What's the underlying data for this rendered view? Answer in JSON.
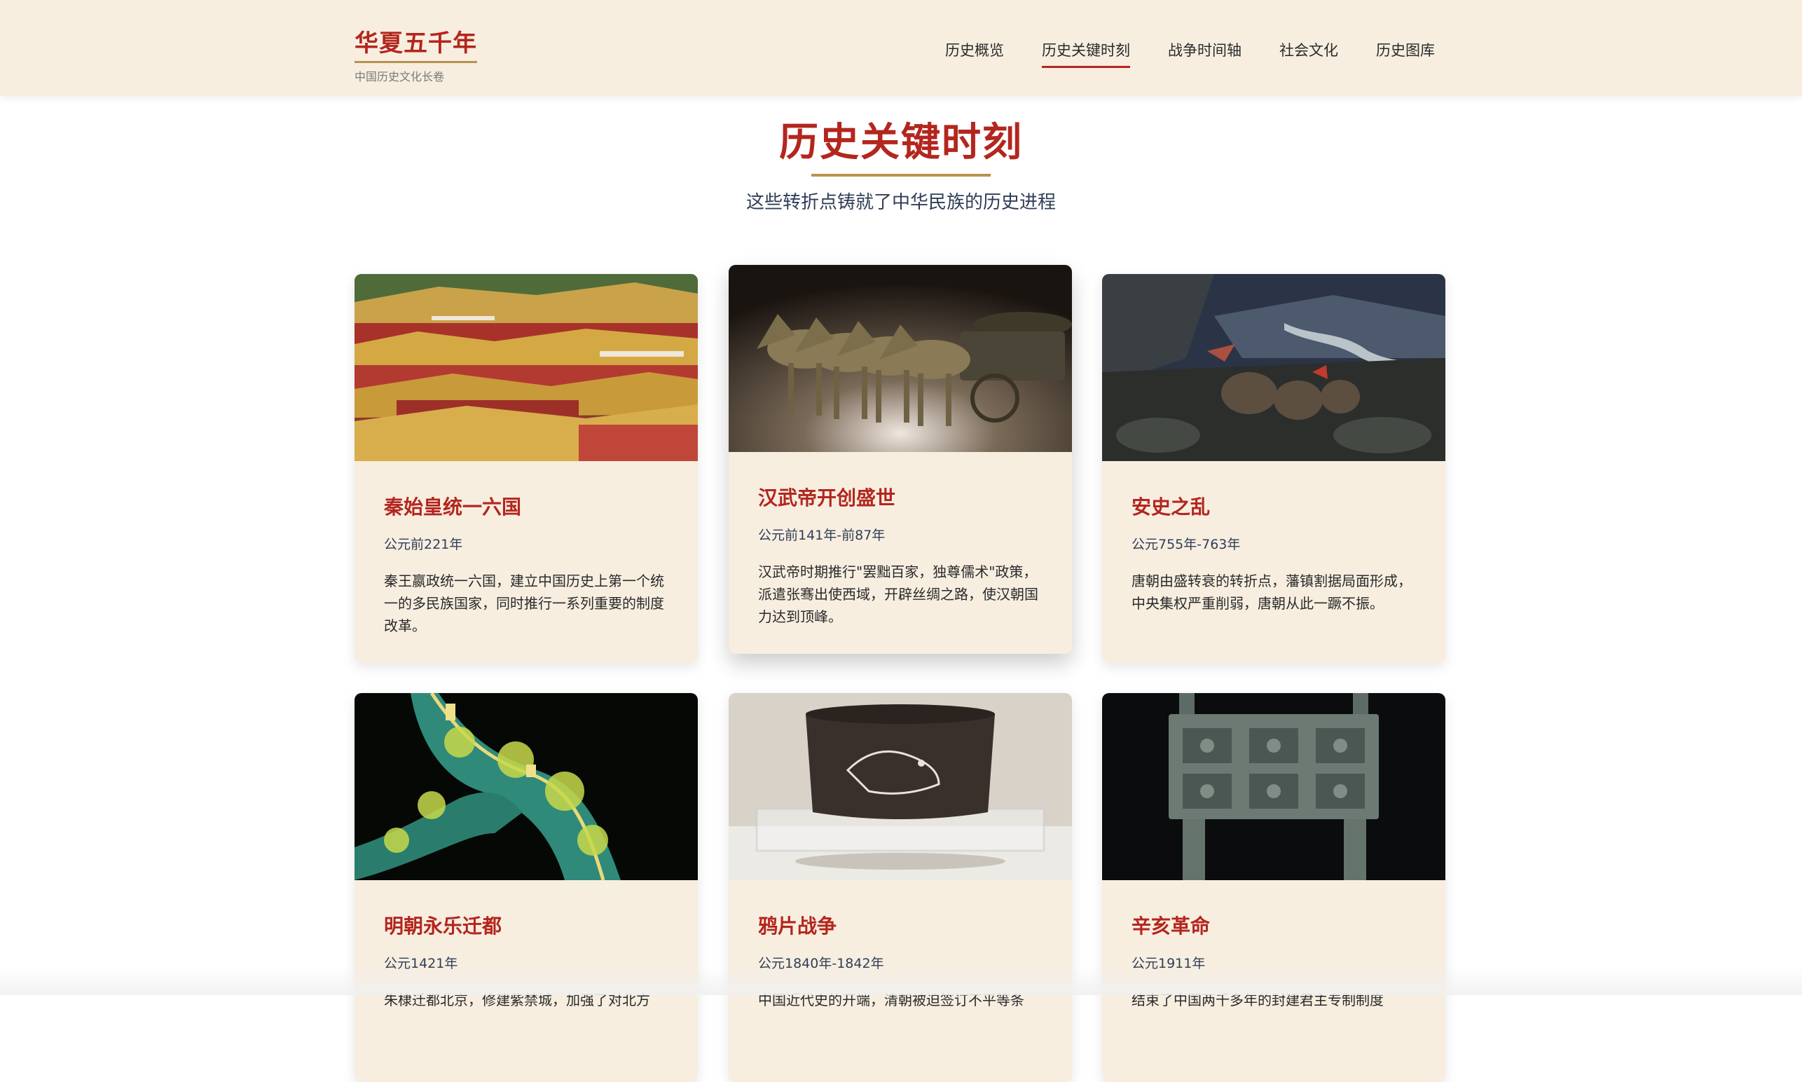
{
  "brand": {
    "title": "华夏五千年",
    "subtitle": "中国历史文化长卷"
  },
  "nav": {
    "items": [
      {
        "label": "历史概览",
        "active": false
      },
      {
        "label": "历史关键时刻",
        "active": true
      },
      {
        "label": "战争时间轴",
        "active": false
      },
      {
        "label": "社会文化",
        "active": false
      },
      {
        "label": "历史图库",
        "active": false
      }
    ]
  },
  "section": {
    "title": "历史关键时刻",
    "subtitle": "这些转折点铸就了中华民族的历史进程"
  },
  "cards": [
    {
      "title": "秦始皇统一六国",
      "date": "公元前221年",
      "text": "秦王嬴政统一六国，建立中国历史上第一个统一的多民族国家，同时推行一系列重要的制度改革。",
      "image": "forbidden-city-roofs-image"
    },
    {
      "title": "汉武帝开创盛世",
      "date": "公元前141年-前87年",
      "text": "汉武帝时期推行\"罢黜百家，独尊儒术\"政策，派遣张骞出使西域，开辟丝绸之路，使汉朝国力达到顶峰。",
      "image": "bronze-chariot-horses-image"
    },
    {
      "title": "安史之乱",
      "date": "公元755年-763年",
      "text": "唐朝由盛转衰的转折点，藩镇割据局面形成，中央集权严重削弱，唐朝从此一蹶不振。",
      "image": "battle-diorama-image"
    },
    {
      "title": "明朝永乐迁都",
      "date": "公元1421年",
      "text": "朱棣迁都北京，修建紫禁城，加强了对北方",
      "image": "great-wall-night-image"
    },
    {
      "title": "鸦片战争",
      "date": "公元1840年-1842年",
      "text": "中国近代史的开端，清朝被迫签订不平等条",
      "image": "stone-vessel-image"
    },
    {
      "title": "辛亥革命",
      "date": "公元1911年",
      "text": "结束了中国两千多年的封建君主专制制度",
      "image": "bronze-ding-image"
    }
  ],
  "colors": {
    "accent_red": "#b3261e",
    "gold": "#b8924f",
    "header_bg": "#f7eee0",
    "card_bg": "#f7eee0",
    "text_navy": "#2f3e57"
  }
}
